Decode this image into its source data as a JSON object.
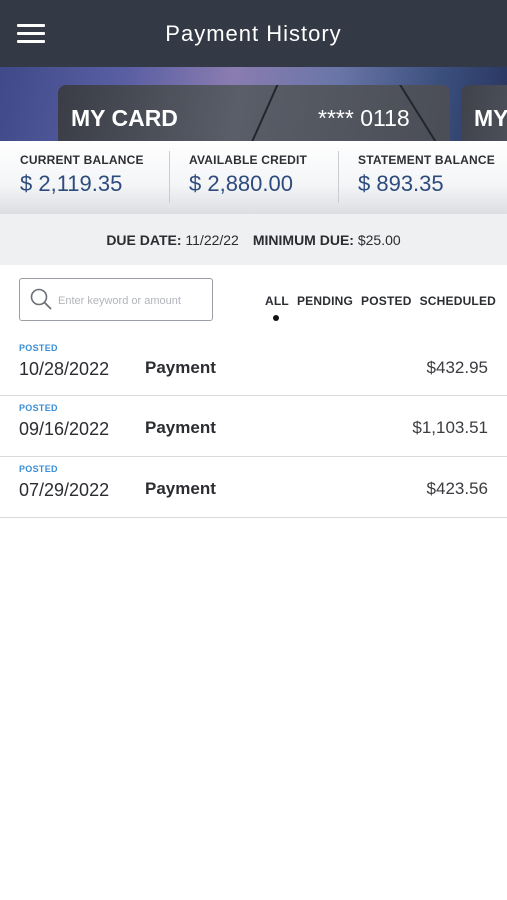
{
  "header": {
    "title": "Payment History",
    "menu_icon": "hamburger-menu-icon"
  },
  "cards": [
    {
      "name": "MY CARD",
      "number": "**** 0118"
    },
    {
      "name": "MY"
    }
  ],
  "balances": [
    {
      "label": "CURRENT BALANCE",
      "value": "$ 2,119.35"
    },
    {
      "label": "AVAILABLE CREDIT",
      "value": "$ 2,880.00"
    },
    {
      "label": "STATEMENT BALANCE",
      "value": "$ 893.35"
    }
  ],
  "due": {
    "due_date_label": "DUE DATE:",
    "due_date": "11/22/22",
    "minimum_due_label": "MINIMUM DUE:",
    "minimum_due": "$25.00"
  },
  "search": {
    "placeholder": "Enter keyword or amount",
    "icon": "search-icon"
  },
  "filters": {
    "items": [
      "ALL",
      "PENDING",
      "POSTED",
      "SCHEDULED"
    ],
    "active": "ALL"
  },
  "transactions": [
    {
      "status": "POSTED",
      "date": "10/28/2022",
      "description": "Payment",
      "amount": "$432.95"
    },
    {
      "status": "POSTED",
      "date": "09/16/2022",
      "description": "Payment",
      "amount": "$1,103.51"
    },
    {
      "status": "POSTED",
      "date": "07/29/2022",
      "description": "Payment",
      "amount": "$423.56"
    }
  ],
  "colors": {
    "header_bg": "#343a45",
    "value_blue": "#2d4b7c",
    "status_blue": "#3a8fd6"
  }
}
